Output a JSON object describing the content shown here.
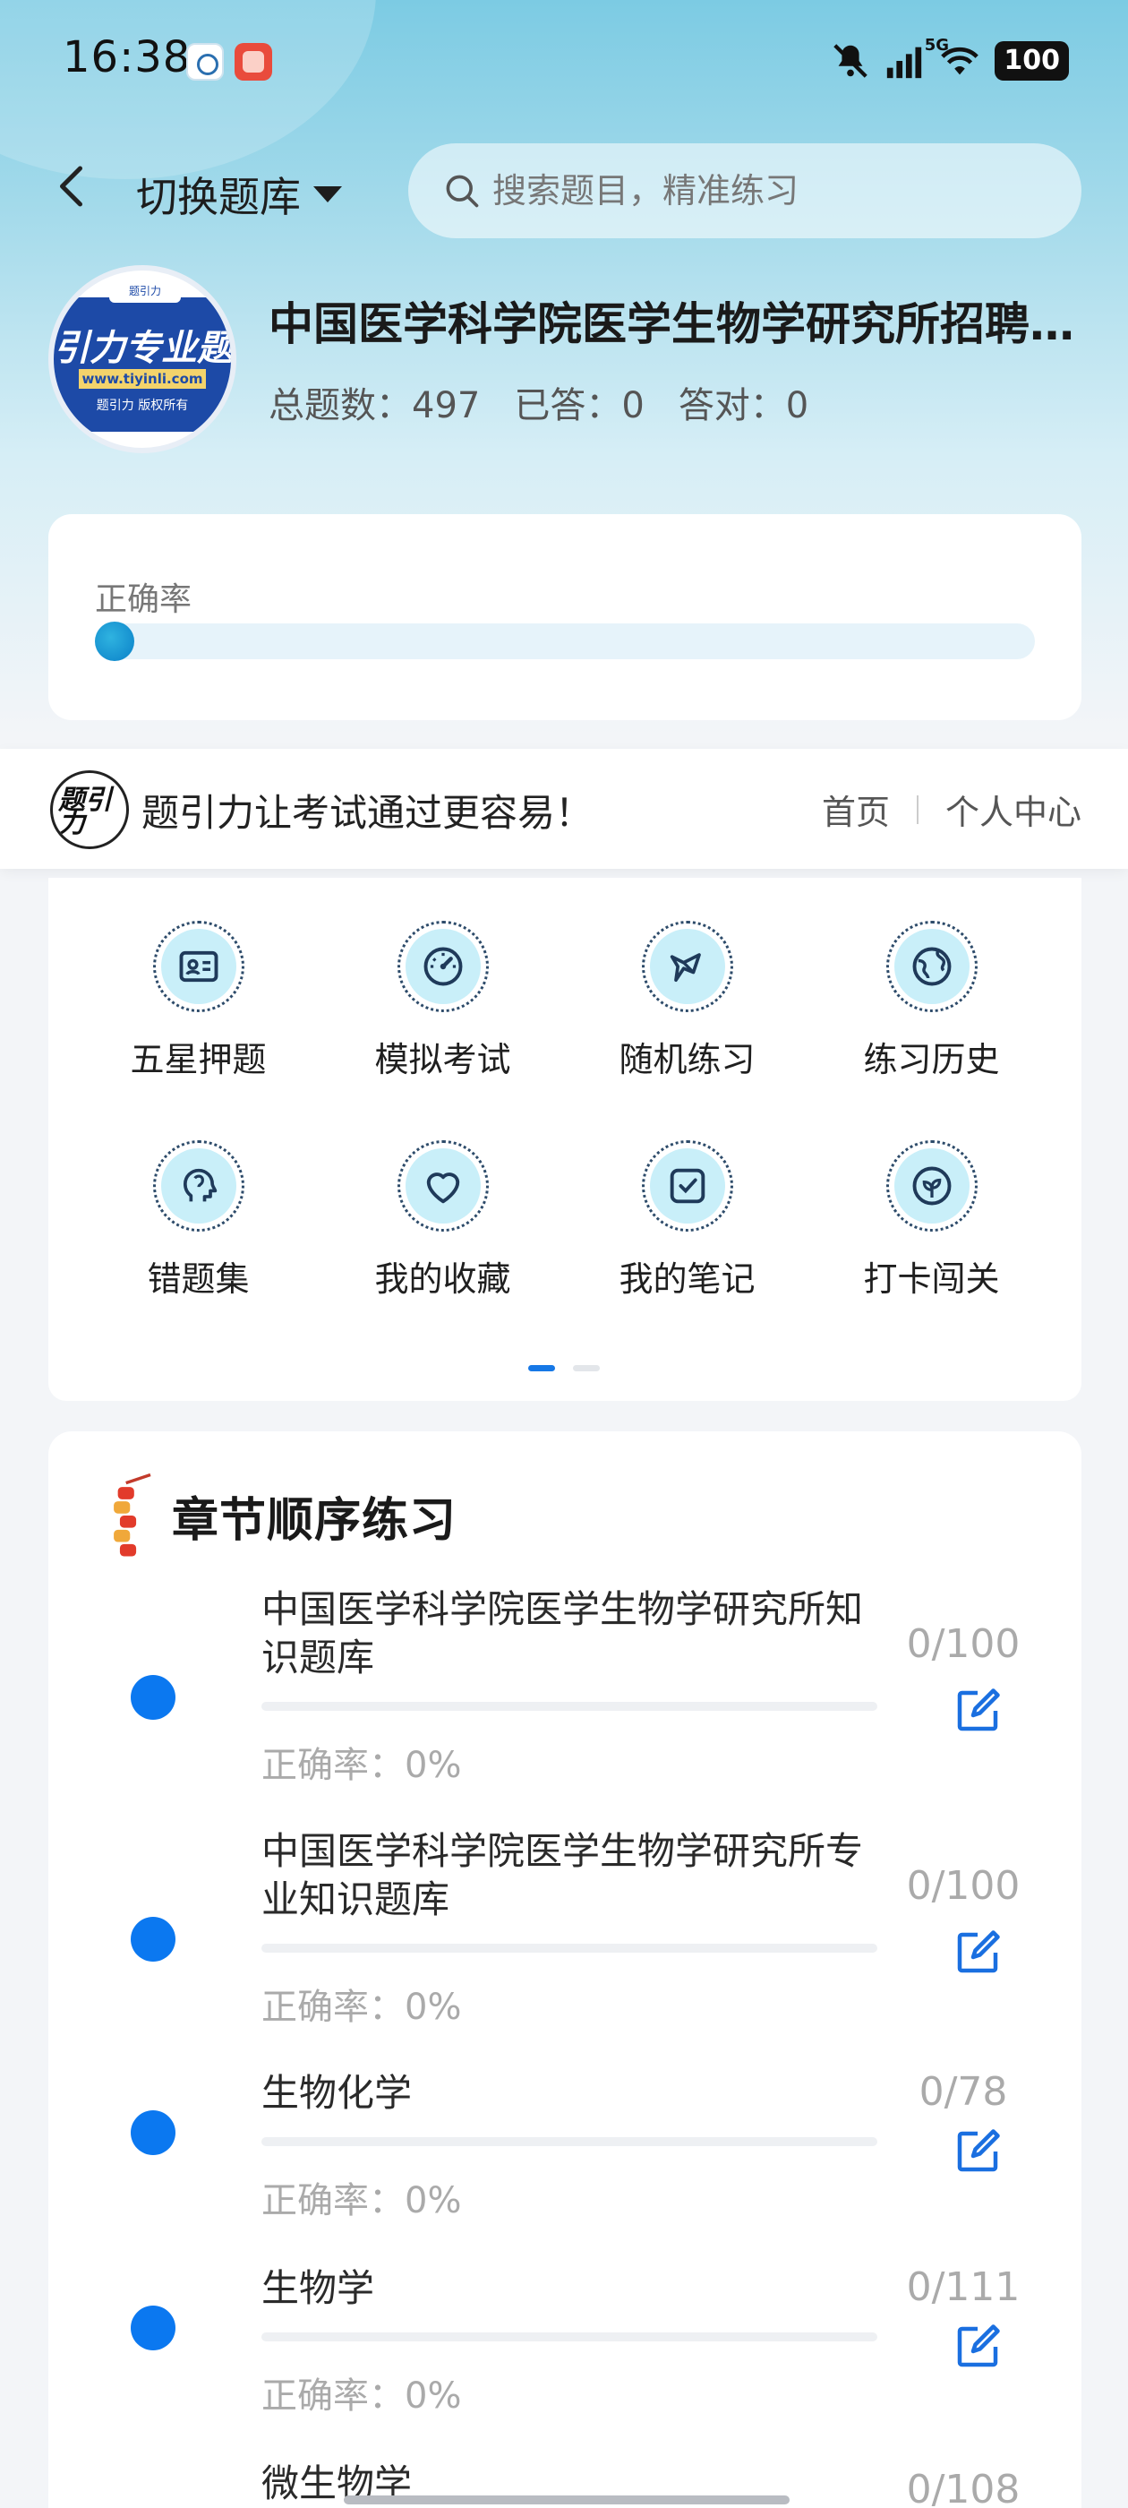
{
  "status_bar": {
    "time": "16:38",
    "network": "5G",
    "battery": "100"
  },
  "header": {
    "switch_label": "切换题库",
    "search_placeholder": "搜索题目，精准练习"
  },
  "course": {
    "logo_top": "题引力",
    "logo_main": "引力专业题",
    "logo_url": "www.tiyinli.com",
    "logo_copy": "题引力 版权所有",
    "title": "中国医学科学院医学生物学研究所招聘考试题库",
    "total_label": "总题数：497",
    "answered_label": "已答：0",
    "correct_label": "答对：0"
  },
  "accuracy": {
    "label": "正确率",
    "value": 0
  },
  "brand": {
    "logo_text": "题引力",
    "slogan": "题引力让考试通过更容易！",
    "links": [
      "首页",
      "个人中心"
    ]
  },
  "features": [
    {
      "label": "五星押题",
      "icon": "id-card-icon"
    },
    {
      "label": "模拟考试",
      "icon": "gauge-icon"
    },
    {
      "label": "随机练习",
      "icon": "shuffle-icon"
    },
    {
      "label": "练习历史",
      "icon": "globe-icon"
    },
    {
      "label": "错题集",
      "icon": "head-icon"
    },
    {
      "label": "我的收藏",
      "icon": "heart-icon"
    },
    {
      "label": "我的笔记",
      "icon": "check-note-icon"
    },
    {
      "label": "打卡闯关",
      "icon": "leaf-icon"
    }
  ],
  "pager": {
    "pages": 2,
    "current": 1
  },
  "chapters": {
    "title": "章节顺序练习",
    "items": [
      {
        "name": "中国医学科学院医学生物学研究所知识题库",
        "rate": "正确率：0%",
        "count": "0/100"
      },
      {
        "name": "中国医学科学院医学生物学研究所专业知识题库",
        "rate": "正确率：0%",
        "count": "0/100"
      },
      {
        "name": "生物化学",
        "rate": "正确率：0%",
        "count": "0/78"
      },
      {
        "name": "生物学",
        "rate": "正确率：0%",
        "count": "0/111"
      },
      {
        "name": "微生物学",
        "rate": "",
        "count": "0/108"
      }
    ]
  },
  "colors": {
    "accent": "#0b78f0",
    "header_top": "#7ccbe3",
    "icon_fill": "#c9eff9"
  }
}
